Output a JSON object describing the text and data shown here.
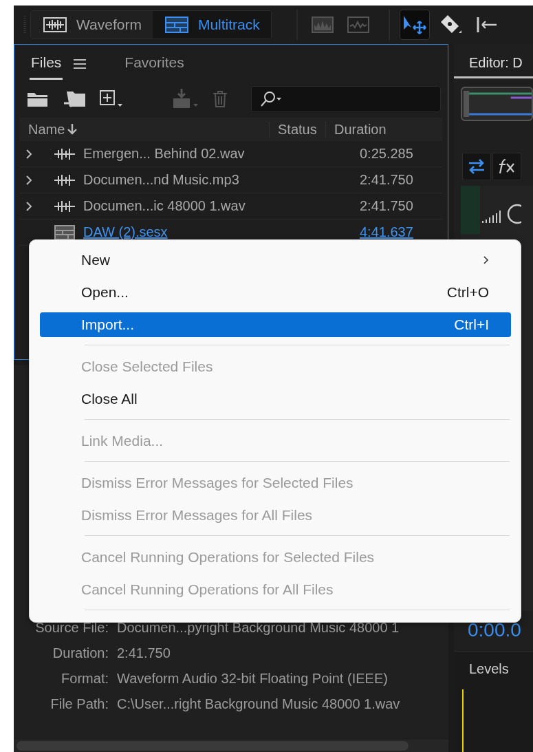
{
  "mode_switch": [
    {
      "label": "Waveform",
      "kind": "waveform",
      "selected": false
    },
    {
      "label": "Multitrack",
      "kind": "multitrack",
      "selected": true
    }
  ],
  "tools": [
    {
      "kind": "spectral",
      "selected": false
    },
    {
      "kind": "wave",
      "selected": false
    },
    {
      "kind": "move",
      "selected": true
    },
    {
      "kind": "razor",
      "selected": false
    },
    {
      "kind": "slip",
      "selected": false
    }
  ],
  "files_panel": {
    "tabs": [
      {
        "label": "Files",
        "selected": true
      },
      {
        "label": "Favorites",
        "selected": false
      }
    ],
    "columns": [
      "Name",
      "Status",
      "Duration"
    ],
    "rows": [
      {
        "kind": "audio",
        "name": "Emergen... Behind 02.wav",
        "duration": "0:25.285",
        "active": false
      },
      {
        "kind": "audio",
        "name": "Documen...nd Music.mp3",
        "duration": "2:41.750",
        "active": false
      },
      {
        "kind": "audio",
        "name": "Documen...ic 48000 1.wav",
        "duration": "2:41.750",
        "active": false
      },
      {
        "kind": "session",
        "name": "DAW (2).sesx",
        "duration": "4:41.637",
        "active": true
      }
    ]
  },
  "properties": [
    {
      "label": "Source File:",
      "value": "Documen...pyright Background Music 48000 1"
    },
    {
      "label": "Duration:",
      "value": "2:41.750"
    },
    {
      "label": "Format:",
      "value": "Waveform Audio 32-bit Floating Point (IEEE)"
    },
    {
      "label": "File Path:",
      "value": "C:\\User...right Background Music 48000 1.wav"
    }
  ],
  "editor_panel": {
    "tab": "Editor: D",
    "time": "0:00.0",
    "levels_title": "Levels"
  },
  "context_menu": [
    {
      "kind": "item",
      "label": "New",
      "submenu": true,
      "disabled": false,
      "selected": false
    },
    {
      "kind": "item",
      "label": "Open...",
      "shortcut": "Ctrl+O",
      "disabled": false,
      "selected": false
    },
    {
      "kind": "item",
      "label": "Import...",
      "shortcut": "Ctrl+I",
      "disabled": false,
      "selected": true
    },
    {
      "kind": "separator"
    },
    {
      "kind": "item",
      "label": "Close Selected Files",
      "disabled": true,
      "selected": false
    },
    {
      "kind": "item",
      "label": "Close All",
      "disabled": false,
      "selected": false
    },
    {
      "kind": "separator"
    },
    {
      "kind": "item",
      "label": "Link Media...",
      "disabled": true,
      "selected": false
    },
    {
      "kind": "separator"
    },
    {
      "kind": "item",
      "label": "Dismiss Error Messages for Selected Files",
      "disabled": true,
      "selected": false
    },
    {
      "kind": "item",
      "label": "Dismiss Error Messages for All Files",
      "disabled": true,
      "selected": false
    },
    {
      "kind": "separator"
    },
    {
      "kind": "item",
      "label": "Cancel Running Operations for Selected Files",
      "disabled": true,
      "selected": false
    },
    {
      "kind": "item",
      "label": "Cancel Running Operations for All Files",
      "disabled": true,
      "selected": false
    },
    {
      "kind": "separator"
    }
  ]
}
